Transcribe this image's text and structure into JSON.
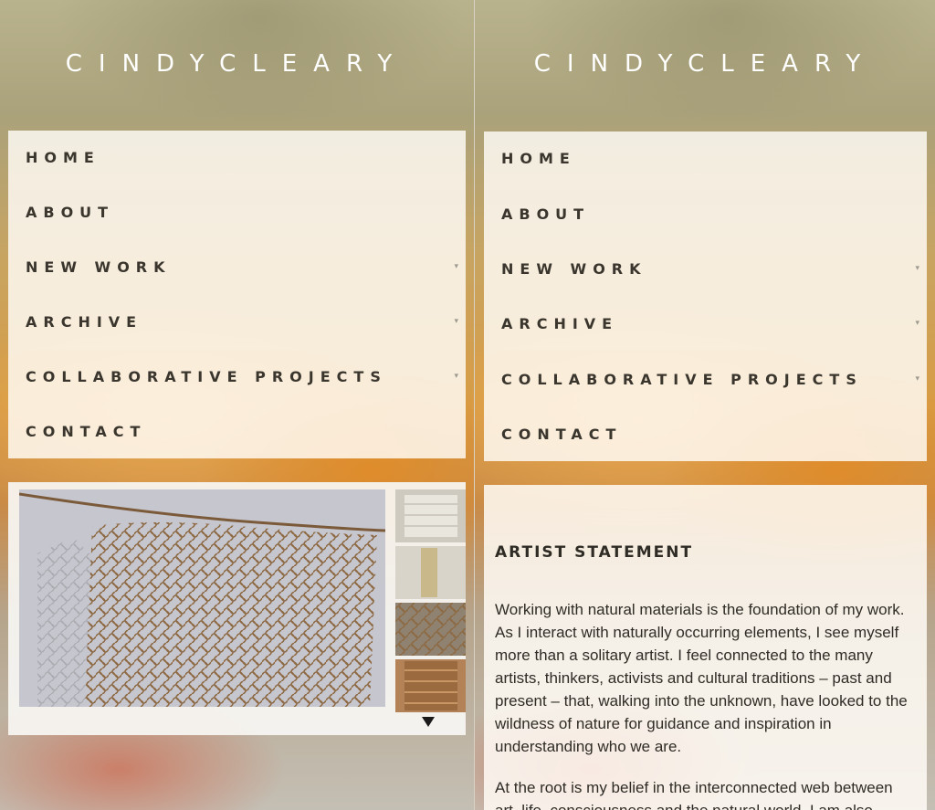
{
  "site": {
    "logo_text": "CINDYCLEARY"
  },
  "menu": {
    "items": [
      {
        "label": "HOME",
        "has_submenu": false
      },
      {
        "label": "ABOUT",
        "has_submenu": false
      },
      {
        "label": "NEW WORK",
        "has_submenu": true
      },
      {
        "label": "ARCHIVE",
        "has_submenu": true
      },
      {
        "label": "COLLABORATIVE PROJECTS",
        "has_submenu": true
      },
      {
        "label": "CONTACT",
        "has_submenu": false
      }
    ],
    "caret_glyph": "▾"
  },
  "gallery": {
    "icons": {
      "main": "woven-net-artwork-image",
      "thumbs": [
        "white-woven-piece-thumb",
        "hanging-fibre-piece-thumb",
        "woven-net-piece-thumb",
        "knotted-brown-panel-thumb"
      ],
      "scroll": "down-arrow-icon"
    }
  },
  "statement": {
    "title": "ARTIST STATEMENT",
    "paragraphs": [
      "Working with natural materials is the foundation of my work. As I interact with naturally occurring elements, I see myself more than a solitary artist. I feel connected to the many artists, thinkers, activists and cultural traditions – past and present – that, walking into the unknown, have looked to the wildness of nature for guidance and inspiration in understanding who we are.",
      "At the root is my belief in the interconnected web between art, life, consciousness and the natural world. I am also"
    ]
  },
  "colors": {
    "menu_text": "#3a362e",
    "logo": "#ffffff",
    "panel_bg": "#fffbf6"
  }
}
